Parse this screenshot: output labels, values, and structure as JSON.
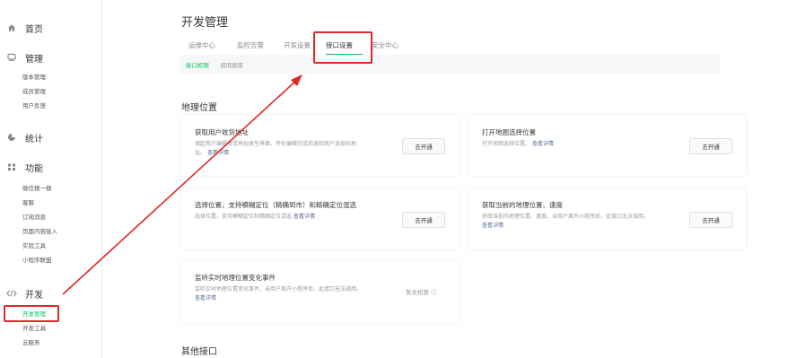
{
  "sidebar": {
    "home": "首页",
    "manage": {
      "label": "管理",
      "items": [
        "版本管理",
        "成员管理",
        "用户反馈"
      ]
    },
    "stats": "统计",
    "features": {
      "label": "功能",
      "items": [
        "微信搜一搜",
        "客服",
        "订阅消息",
        "页面内容接入",
        "实验工具",
        "小程序联盟"
      ]
    },
    "dev": {
      "label": "开发",
      "items": [
        "开发管理",
        "开发工具",
        "云服务"
      ]
    }
  },
  "icons": {
    "home": "home-icon",
    "manage": "monitor-icon",
    "stats": "pie-chart-icon",
    "features": "grid-icon",
    "dev": "code-icon"
  },
  "page": {
    "title": "开发管理",
    "tabs": [
      "运维中心",
      "监控告警",
      "开发设置",
      "接口设置",
      "安全中心"
    ],
    "subtabs": [
      "接口权限",
      "调用额度"
    ]
  },
  "section_geo": {
    "title": "地理位置",
    "cards": [
      {
        "title": "获取用户收货地址",
        "desc1": "调起用户编辑收货地址原生界面，并在编辑完成后返回用户选择的地",
        "desc2": "址。",
        "link": "查看详情",
        "action": "去开通"
      },
      {
        "title": "打开地图选择位置",
        "desc1": "打开地图选择位置。",
        "desc2": "",
        "link": "查看详情",
        "action": "去开通"
      },
      {
        "title": "选择位置，支持模糊定位（精确到市）和精确定位混选",
        "desc1": "选择位置，支持模糊定位和精确定位混选",
        "desc2": "",
        "link": "查看详情",
        "action": "去开通"
      },
      {
        "title": "获取当前的地理位置、速度",
        "desc1": "获取当前的地理位置、速度。当用户离开小程序后，此接口无法调用。",
        "desc2": "",
        "link": "查看详情",
        "action": "去开通"
      },
      {
        "title": "监听实时地理位置变化事件",
        "desc1": "监听实时地理位置变化事件，当用户离开小程序后，此接口无法调用。",
        "desc2": "",
        "link": "查看详情",
        "status": "暂无权限 ⓘ"
      }
    ]
  },
  "section_other": {
    "title": "其他接口"
  },
  "colors": {
    "accent": "#07c160",
    "highlight": "#e02828",
    "link": "#576b95"
  }
}
